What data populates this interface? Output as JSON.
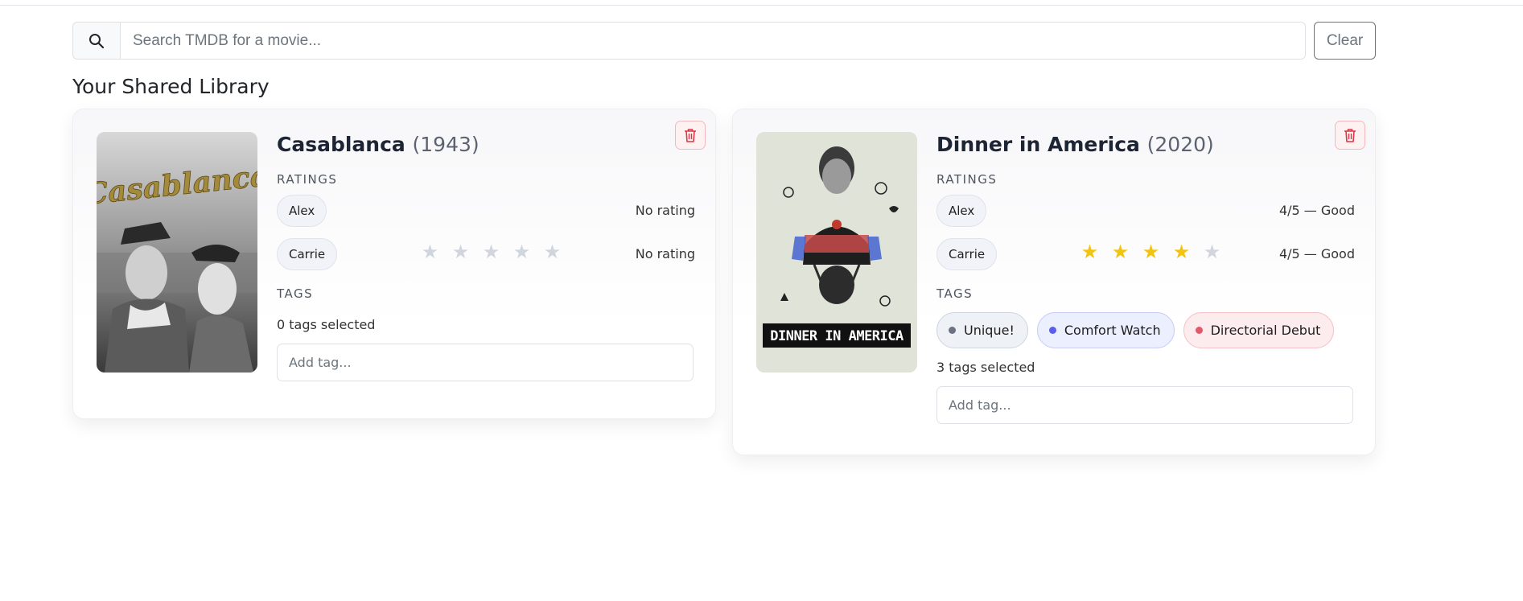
{
  "search": {
    "placeholder": "Search TMDB for a movie...",
    "value": "",
    "clear_label": "Clear",
    "icon": "search-icon"
  },
  "library": {
    "title": "Your Shared Library",
    "ratings_label": "RATINGS",
    "tags_label": "TAGS",
    "add_tag_placeholder": "Add tag...",
    "movies": [
      {
        "title": "Casablanca",
        "year": "(1943)",
        "poster_text": "Casablanca",
        "ratings": [
          {
            "name": "Alex",
            "stars": 0,
            "text": "No rating",
            "show_stars": false
          },
          {
            "name": "Carrie",
            "stars": 0,
            "text": "No rating",
            "show_stars": true
          }
        ],
        "tags": [],
        "tags_count": "0 tags selected"
      },
      {
        "title": "Dinner in America",
        "year": "(2020)",
        "poster_text": "DINNER IN AMERICA",
        "ratings": [
          {
            "name": "Alex",
            "stars": 4,
            "text": "4/5 — Good",
            "show_stars": false
          },
          {
            "name": "Carrie",
            "stars": 4,
            "text": "4/5 — Good",
            "show_stars": true
          }
        ],
        "tags": [
          {
            "label": "Unique!",
            "dot": "#6b7280",
            "bg": "#eef1f6",
            "border": "#cfd6e2"
          },
          {
            "label": "Comfort Watch",
            "dot": "#5b5ee6",
            "bg": "#eceffd",
            "border": "#c7cdf5"
          },
          {
            "label": "Directorial Debut",
            "dot": "#e05a6a",
            "bg": "#fdecee",
            "border": "#f4c2c8"
          }
        ],
        "tags_count": "3 tags selected"
      }
    ]
  },
  "colors": {
    "star_on": "#f3c40d",
    "star_off": "#d1d6de",
    "delete_accent": "#dc3545"
  }
}
